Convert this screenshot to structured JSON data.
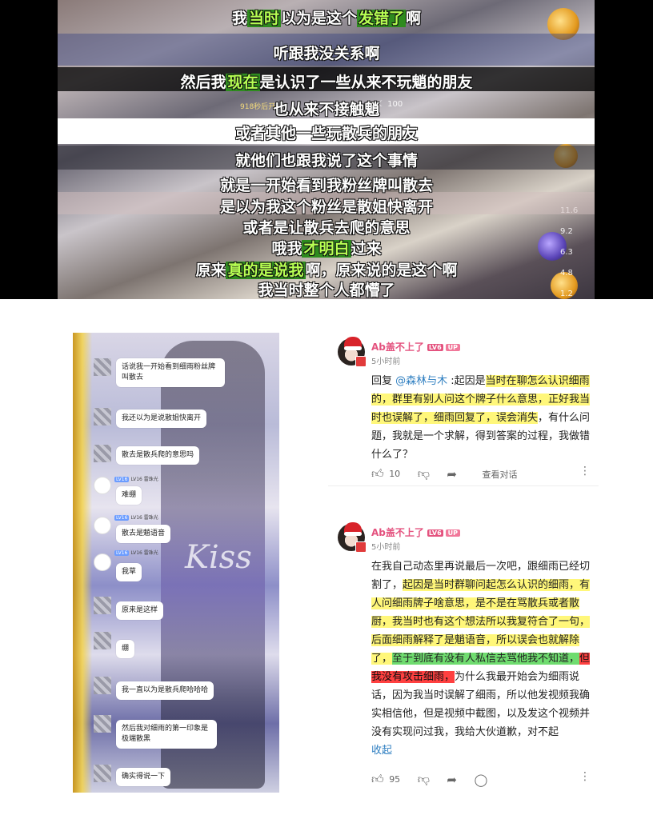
{
  "video": {
    "subtitles": [
      {
        "pre": "我",
        "hl": "当时",
        "mid": "以为是这个",
        "hl2": "发错了",
        "post": "啊"
      },
      {
        "text": "听跟我没关系啊"
      },
      {
        "pre": "然后我",
        "hl": "现在",
        "post": "是认识了一些从来不玩魈的朋友"
      },
      {
        "text": "也从来不接触魈"
      },
      {
        "text": "或者其他一些玩散兵的朋友"
      },
      {
        "text": "就他们也跟我说了这个事情"
      },
      {
        "text": "就是一开始看到我粉丝牌叫散去"
      },
      {
        "text": "是以为我这个粉丝是散姐快离开"
      },
      {
        "text": "或者是让散兵去爬的意思"
      },
      {
        "pre": "哦我",
        "hl": "才明白",
        "post": "过来"
      },
      {
        "pre": "原来",
        "hl": "真的是说我",
        "post": "啊，原来说的是这个啊"
      },
      {
        "text": "我当时整个人都懵了"
      }
    ],
    "game_ui": {
      "small_text": "918秒后开",
      "moon_count": "100",
      "numbers": [
        "11.6",
        "9.2",
        "6.3",
        "4.8",
        "1.2"
      ]
    }
  },
  "chat": {
    "messages": [
      "话说我一开始看到细雨粉丝牌叫散去",
      "我还以为是说散姐快离开",
      "散去是散兵爬的意思吗",
      "难绷",
      "散去是魈语音",
      "我草",
      "原来是这样",
      "绷",
      "我一直以为是散兵爬哈哈哈",
      "然后我对细雨的第一印象是极端散黑",
      "确实得说一下"
    ],
    "tags": [
      "LV16 雷珠光",
      "LV16 雷珠光",
      "LV16 雷珠光"
    ],
    "watermark": "Kiss"
  },
  "comments": [
    {
      "user": "Ab盖不上了",
      "level": "LV6",
      "up_badge": "UP",
      "time": "5小时前",
      "reply_prefix": "回复 ",
      "mention": "@森林与木",
      "body_a": " :起因是",
      "body_hl": "当时在聊怎么认识细雨的，群里有别人问这个牌子什么意思，正好我当时也误解了，细雨回复了，误会消失",
      "body_b": "，有什么问题，我就是一个求解，得到答案的过程，我做错什么了？",
      "likes": "10",
      "view_dialog": "查看对话"
    },
    {
      "user": "Ab盖不上了",
      "level": "LV6",
      "up_badge": "UP",
      "time": "5小时前",
      "body_a": "在我自己动态里再说最后一次吧，跟细雨已经切割了，",
      "body_hl": "起因是当时群聊问起怎么认识的细雨，有人问细雨牌子啥意思，是不是在骂散兵或者散厨，我当时也有这个想法所以我复符合了一句，后面细雨解释了是魈语音，所以误会也就解除了，",
      "body_green": "至于到底有没有人私信去骂他我不知道，",
      "body_red": "但我没有攻击细雨，",
      "body_b": "为什么我最开始会为细雨说话，因为我当时误解了细雨，所以他发视频我确实相信他，但是视频中截图，以及发这个视频并没有实现问过我，我给大伙道歉，对不起",
      "collapse": "收起",
      "likes": "95"
    }
  ],
  "icons": [
    "thumb-up-icon",
    "thumb-down-icon",
    "share-icon",
    "comment-icon",
    "more-icon"
  ]
}
